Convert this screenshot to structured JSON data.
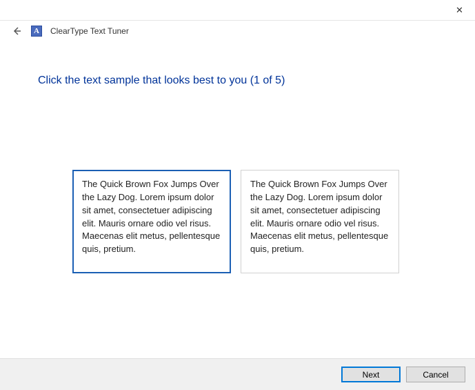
{
  "window": {
    "close_label": "✕",
    "app_title": "ClearType Text Tuner",
    "app_icon_glyph": "A"
  },
  "instruction": "Click the text sample that looks best to you (1 of 5)",
  "samples": [
    {
      "text": "The Quick Brown Fox Jumps Over the Lazy Dog. Lorem ipsum dolor sit amet, consectetuer adipiscing elit. Mauris ornare odio vel risus. Maecenas elit metus, pellentesque quis, pretium.",
      "selected": true
    },
    {
      "text": "The Quick Brown Fox Jumps Over the Lazy Dog. Lorem ipsum dolor sit amet, consectetuer adipiscing elit. Mauris ornare odio vel risus. Maecenas elit metus, pellentesque quis, pretium.",
      "selected": false
    }
  ],
  "footer": {
    "next_label": "Next",
    "cancel_label": "Cancel"
  }
}
